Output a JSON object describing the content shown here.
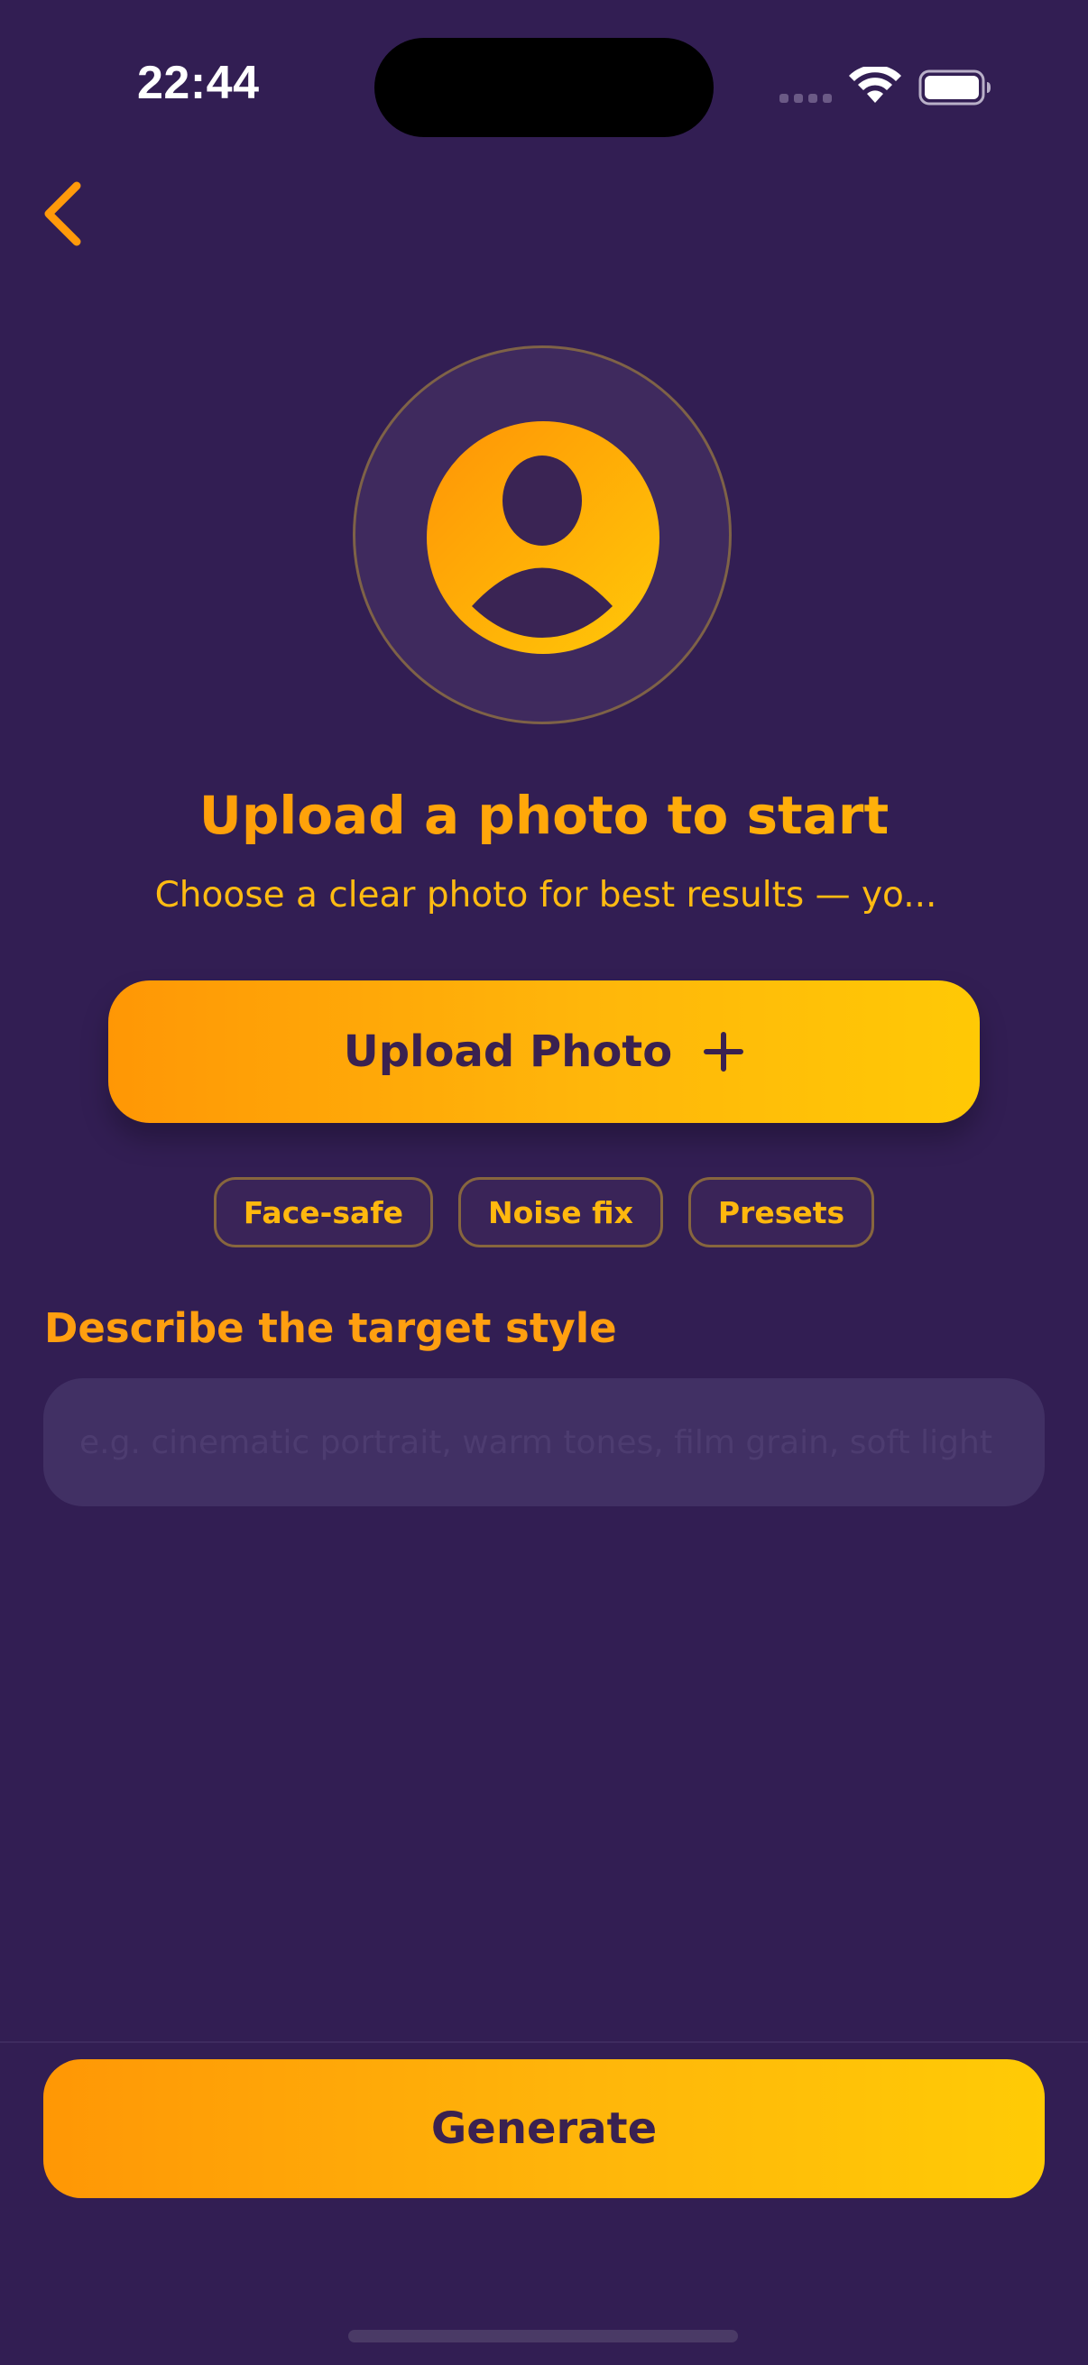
{
  "status_bar": {
    "time": "22:44",
    "wifi_icon": "wifi-icon",
    "battery_icon": "battery-icon"
  },
  "nav": {
    "back_icon": "chevron-left-icon"
  },
  "hero": {
    "avatar_icon": "user-avatar-icon",
    "headline": "Upload a photo to start",
    "subtext": "Choose a clear photo for best results — yo..."
  },
  "upload": {
    "label": "Upload Photo",
    "icon": "plus-icon"
  },
  "chips": [
    "Face-safe",
    "Noise fix",
    "Presets"
  ],
  "describe": {
    "label": "Describe the target style",
    "placeholder": "e.g. cinematic portrait, warm tones, film grain, soft light",
    "value": ""
  },
  "generate": {
    "label": "Generate"
  },
  "colors": {
    "background": "#321E53",
    "accent_start": "#FF9705",
    "accent_end": "#FFC905",
    "accent_text": "#FFA20E",
    "button_text": "#3A2150"
  }
}
